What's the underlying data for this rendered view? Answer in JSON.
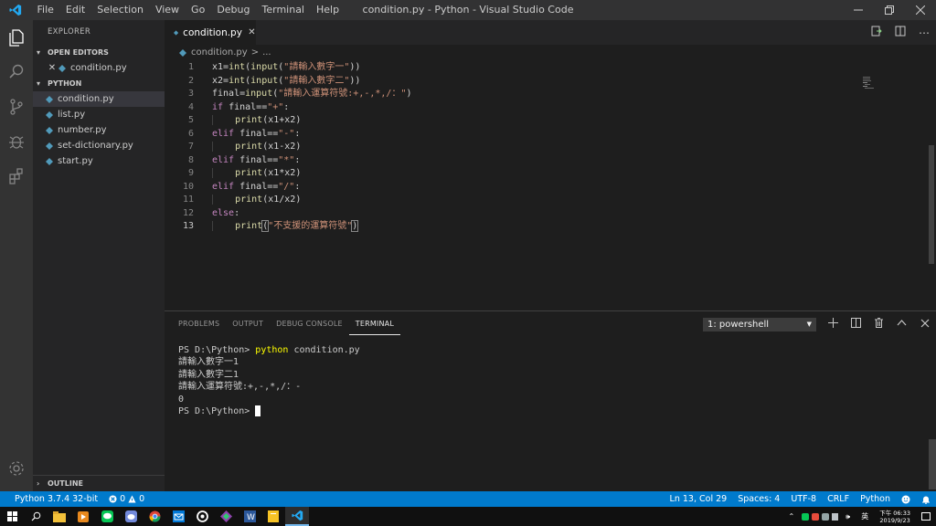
{
  "titlebar": {
    "menu": [
      "File",
      "Edit",
      "Selection",
      "View",
      "Go",
      "Debug",
      "Terminal",
      "Help"
    ],
    "window_title": "condition.py - Python - Visual Studio Code"
  },
  "sidebar": {
    "title": "EXPLORER",
    "open_editors_label": "OPEN EDITORS",
    "open_editors": [
      {
        "label": "condition.py"
      }
    ],
    "folder_label": "PYTHON",
    "files": [
      {
        "label": "condition.py"
      },
      {
        "label": "list.py"
      },
      {
        "label": "number.py"
      },
      {
        "label": "set-dictionary.py"
      },
      {
        "label": "start.py"
      }
    ],
    "outline_label": "OUTLINE"
  },
  "editor": {
    "tab_label": "condition.py",
    "breadcrumb_file": "condition.py",
    "breadcrumb_sep": ">",
    "breadcrumb_rest": "...",
    "line_numbers": [
      "1",
      "2",
      "3",
      "4",
      "5",
      "6",
      "7",
      "8",
      "9",
      "10",
      "11",
      "12",
      "13"
    ]
  },
  "panel": {
    "tabs": [
      "PROBLEMS",
      "OUTPUT",
      "DEBUG CONSOLE",
      "TERMINAL"
    ],
    "terminal_select": "1: powershell",
    "terminal": {
      "prompt1": "PS D:\\Python> ",
      "cmd_word": "python",
      "cmd_rest": " condition.py",
      "line2": "請輸入數字一1",
      "line3": "請輸入數字二1",
      "line4": "請輸入運算符號:+,-,*,/：-",
      "line5": "0",
      "prompt2": "PS D:\\Python> "
    }
  },
  "statusbar": {
    "interpreter": "Python 3.7.4 32-bit",
    "errors": "0",
    "warnings": "0",
    "position": "Ln 13, Col 29",
    "spaces": "Spaces: 4",
    "encoding": "UTF-8",
    "eol": "CRLF",
    "language": "Python"
  },
  "taskbar": {
    "ime": "英",
    "time_line1": "下午 06:33",
    "time_line2": "2019/9/23"
  },
  "colors": {
    "accent": "#007acc",
    "keyword": "#c586c0",
    "function": "#dcdcaa",
    "string": "#ce9178"
  }
}
